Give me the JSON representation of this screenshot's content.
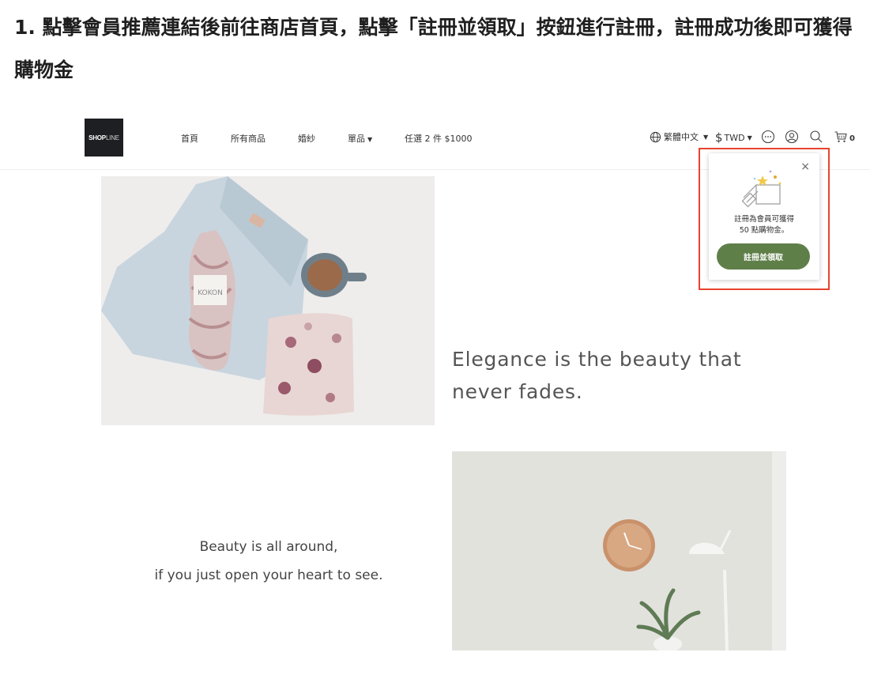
{
  "instruction": {
    "text": "1. 點擊會員推薦連結後前往商店首頁，點擊「註冊並領取」按鈕進行註冊，註冊成功後即可獲得購物金"
  },
  "header": {
    "logo_text_bold": "SHOP",
    "logo_text_light": "LINE",
    "nav": [
      {
        "label": "首頁"
      },
      {
        "label": "所有商品"
      },
      {
        "label": "婚紗"
      },
      {
        "label": "單品"
      },
      {
        "label": "任選 2 件 $1000"
      }
    ],
    "language": "繁體中文",
    "currency_symbol": "$",
    "currency": "TWD",
    "cart_count": "0"
  },
  "popup": {
    "line1": "註冊為會員可獲得",
    "line2": "50 點購物金。",
    "button": "註冊並領取"
  },
  "content": {
    "image1_label": "KOKON",
    "quote1_line1": "Elegance is the beauty that",
    "quote1_line2": "never fades.",
    "quote2_line1": "Beauty is all around,",
    "quote2_line2": "if you just open your heart to see."
  },
  "colors": {
    "accent_button": "#5f7f49",
    "highlight_box": "#e8432e"
  },
  "icons": [
    "globe-icon",
    "chat-icon",
    "user-icon",
    "search-icon",
    "cart-icon",
    "close-icon",
    "gift-icon"
  ]
}
